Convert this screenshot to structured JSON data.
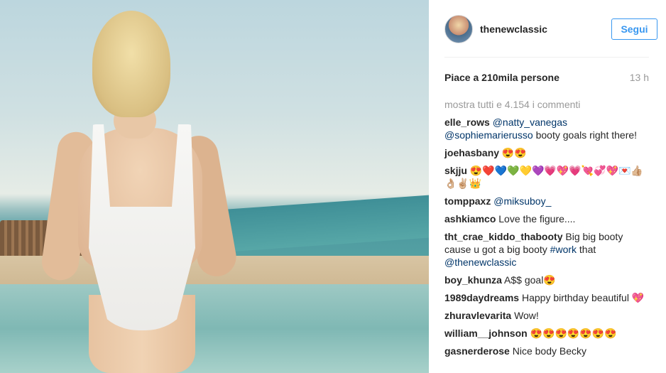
{
  "post": {
    "username": "thenewclassic",
    "follow_label": "Segui",
    "likes_text": "Piace a 210mila persone",
    "time": "13 h",
    "show_all_comments": "mostra tutti e 4.154 i commenti"
  },
  "comments": [
    {
      "user": "elle_rows",
      "parts": [
        {
          "t": "@natty_vanegas",
          "link": true
        },
        {
          "t": " ",
          "link": false
        },
        {
          "t": "@sophiemarierusso",
          "link": true
        },
        {
          "t": " booty goals right there!",
          "link": false
        }
      ]
    },
    {
      "user": "joehasbany",
      "parts": [
        {
          "t": "😍😍",
          "link": false
        }
      ]
    },
    {
      "user": "skjju",
      "parts": [
        {
          "t": "😍❤️💙💚💛💜💗💖💗💘💞💖💌👍🏼👌🏼✌🏼👑",
          "link": false
        }
      ]
    },
    {
      "user": "tomppaxz",
      "parts": [
        {
          "t": "@miksuboy_",
          "link": true
        }
      ]
    },
    {
      "user": "ashkiamco",
      "parts": [
        {
          "t": "Love the figure....",
          "link": false
        }
      ]
    },
    {
      "user": "tht_crae_kiddo_thabooty",
      "parts": [
        {
          "t": "Big big booty cause u got a big booty ",
          "link": false
        },
        {
          "t": "#work",
          "link": true
        },
        {
          "t": " that ",
          "link": false
        },
        {
          "t": "@thenewclassic",
          "link": true
        }
      ]
    },
    {
      "user": "boy_khunza",
      "parts": [
        {
          "t": "A$$ goal😍",
          "link": false
        }
      ]
    },
    {
      "user": "1989daydreams",
      "parts": [
        {
          "t": "Happy birthday beautiful 💖",
          "link": false
        }
      ]
    },
    {
      "user": "zhuravlevarita",
      "parts": [
        {
          "t": "Wow!",
          "link": false
        }
      ]
    },
    {
      "user": "william__johnson",
      "parts": [
        {
          "t": "😍😍😍😍😍😍😍",
          "link": false
        }
      ]
    },
    {
      "user": "gasnerderose",
      "parts": [
        {
          "t": "Nice body Becky",
          "link": false
        }
      ]
    }
  ]
}
